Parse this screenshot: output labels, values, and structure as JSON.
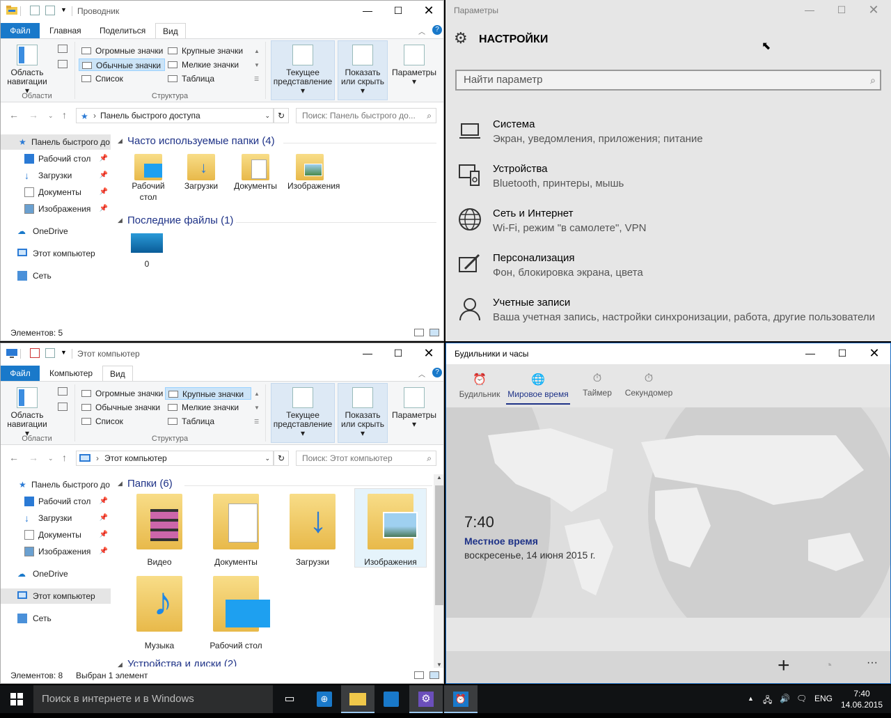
{
  "explorer1": {
    "title": "Проводник",
    "tabs": [
      "Файл",
      "Главная",
      "Поделиться",
      "Вид"
    ],
    "ribbon": {
      "nav_area": "Область навигации",
      "group_areas": "Области",
      "layouts": [
        "Огромные значки",
        "Крупные значки",
        "Обычные значки",
        "Мелкие значки",
        "Список",
        "Таблица"
      ],
      "group_structure": "Структура",
      "current_view": "Текущее представление",
      "show_hide": "Показать или скрыть",
      "options": "Параметры"
    },
    "address": "Панель быстрого доступа",
    "search_placeholder": "Поиск: Панель быстрого до...",
    "nav": {
      "quick": "Панель быстрого до",
      "desktop": "Рабочий стол",
      "downloads": "Загрузки",
      "documents": "Документы",
      "pictures": "Изображения",
      "onedrive": "OneDrive",
      "thispc": "Этот компьютер",
      "network": "Сеть"
    },
    "group_frequent": "Часто используемые папки (4)",
    "frequent": [
      "Рабочий стол",
      "Загрузки",
      "Документы",
      "Изображения"
    ],
    "group_recent": "Последние файлы (1)",
    "recent": [
      "0"
    ],
    "status": "Элементов: 5"
  },
  "explorer2": {
    "title": "Этот компьютер",
    "tabs": [
      "Файл",
      "Компьютер",
      "Вид"
    ],
    "address": "Этот компьютер",
    "search_placeholder": "Поиск: Этот компьютер",
    "group_folders": "Папки (6)",
    "folders": [
      "Видео",
      "Документы",
      "Загрузки",
      "Изображения",
      "Музыка",
      "Рабочий стол"
    ],
    "group_devices": "Устройства и диски (2)",
    "status_count": "Элементов: 8",
    "status_selected": "Выбран 1 элемент"
  },
  "settings": {
    "window_title": "Параметры",
    "header": "НАСТРОЙКИ",
    "search_placeholder": "Найти параметр",
    "categories": [
      {
        "title": "Система",
        "sub": "Экран, уведомления, приложения; питание"
      },
      {
        "title": "Устройства",
        "sub": "Bluetooth, принтеры, мышь"
      },
      {
        "title": "Сеть и Интернет",
        "sub": "Wi-Fi, режим \"в самолете\", VPN"
      },
      {
        "title": "Персонализация",
        "sub": "Фон, блокировка экрана, цвета"
      },
      {
        "title": "Учетные записи",
        "sub": "Ваша учетная запись, настройки синхронизации, работа, другие пользователи"
      }
    ]
  },
  "alarms": {
    "window_title": "Будильники и часы",
    "tabs": [
      "Будильник",
      "Мировое время",
      "Таймер",
      "Секундомер"
    ],
    "time": "7:40",
    "local_label": "Местное время",
    "date": "воскресенье, 14 июня 2015 г."
  },
  "taskbar": {
    "search_placeholder": "Поиск в интернете и в Windows",
    "lang": "ENG",
    "time": "7:40",
    "date": "14.06.2015"
  },
  "colors": {
    "accent": "#1979ca",
    "group_header": "#1e3287",
    "taskbar": "#101214"
  }
}
